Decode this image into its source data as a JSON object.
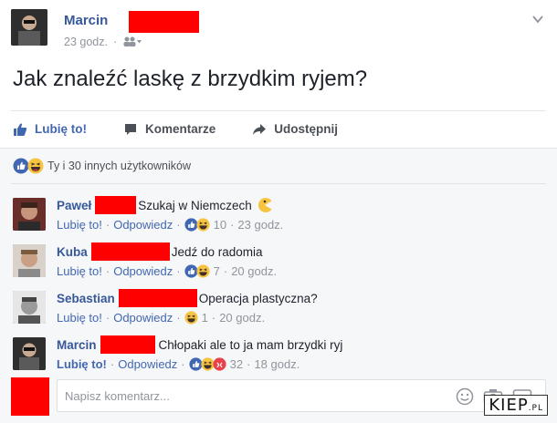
{
  "post": {
    "author": "Marcin",
    "time": "23 godz.",
    "text": "Jak znaleźć laskę z brzydkim ryjem?"
  },
  "actions": {
    "like": "Lubię to!",
    "comment": "Komentarze",
    "share": "Udostępnij"
  },
  "reactions_summary": "Ty i 30 innych użytkowników",
  "comments": [
    {
      "author": "Paweł",
      "text": "Szukaj w Niemczech",
      "like": "Lubię to!",
      "reply": "Odpowiedz",
      "count": "10",
      "time": "23 godz."
    },
    {
      "author": "Kuba",
      "text": "Jedź do radomia",
      "like": "Lubię to!",
      "reply": "Odpowiedz",
      "count": "7",
      "time": "20 godz."
    },
    {
      "author": "Sebastian",
      "text": "Operacja plastyczna?",
      "like": "Lubię to!",
      "reply": "Odpowiedz",
      "count": "1",
      "time": "20 godz."
    },
    {
      "author": "Marcin",
      "text": "Chłopaki ale to ja mam brzydki ryj",
      "like": "Lubię to!",
      "reply": "Odpowiedz",
      "count": "32",
      "time": "18 godz."
    }
  ],
  "composer": {
    "placeholder": "Napisz komentarz..."
  },
  "watermark": {
    "main": "KIEP",
    "suffix": ".PL"
  },
  "colors": {
    "link": "#365899",
    "like_blue": "#4267b2",
    "redaction": "#ff0000",
    "muted": "#90949c"
  },
  "icons": [
    "thumbs-up-icon",
    "comment-icon",
    "share-arrow-icon",
    "like-reaction-icon",
    "haha-reaction-icon",
    "wow-reaction-icon",
    "pacman-emoji-icon",
    "smiley-icon",
    "camera-icon",
    "gif-icon",
    "chevron-down-icon",
    "friends-audience-icon"
  ]
}
